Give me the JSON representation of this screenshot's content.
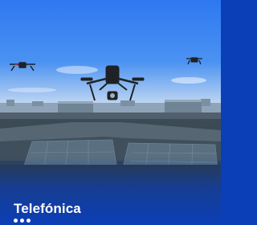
{
  "ad": {
    "brand_name": "Telefónica",
    "logo_icon": "telefonica-dots-logo-icon",
    "image_subject": "drones-over-rooftop-photo",
    "colors": {
      "sky_top": "#2f7bf2",
      "sky_bottom": "#c9dcf3",
      "overlay": "#0b3fb8",
      "text": "#ffffff"
    }
  }
}
